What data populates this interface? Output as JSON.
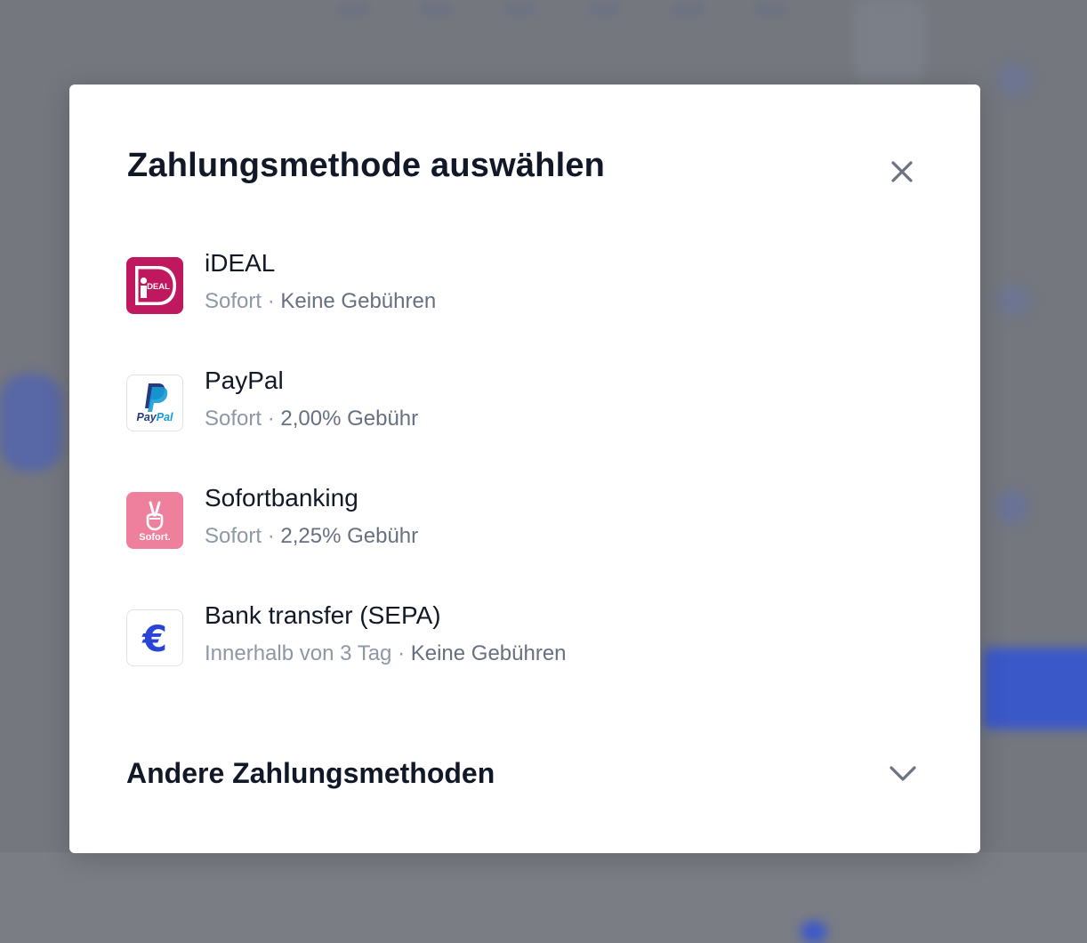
{
  "modal": {
    "title": "Zahlungsmethode auswählen",
    "close_icon": "close-icon"
  },
  "methods": [
    {
      "name": "iDEAL",
      "speed": "Sofort",
      "separator": "·",
      "fee": "Keine Gebühren",
      "icon": "ideal-logo-icon",
      "logo_text": "iDEAL",
      "color": "#c0185f"
    },
    {
      "name": "PayPal",
      "speed": "Sofort",
      "separator": "·",
      "fee": "2,00% Gebühr",
      "icon": "paypal-logo-icon",
      "logo_text": "PayPal",
      "color": "#253b80"
    },
    {
      "name": "Sofortbanking",
      "speed": "Sofort",
      "separator": "·",
      "fee": "2,25% Gebühr",
      "icon": "sofort-logo-icon",
      "logo_text": "Sofort.",
      "color": "#ef809d"
    },
    {
      "name": "Bank transfer (SEPA)",
      "speed": "Innerhalb von 3 Tag",
      "separator": "·",
      "fee": "Keine Gebühren",
      "icon": "euro-icon",
      "logo_text": "€",
      "color": "#2a45d6"
    }
  ],
  "other_methods": {
    "label": "Andere Zahlungsmethoden",
    "icon": "chevron-down-icon"
  },
  "colors": {
    "overlay": "#74777e",
    "title_text": "#111827",
    "muted_text": "#8e97a5",
    "fee_text": "#677080",
    "icon_gray": "#6b7280"
  }
}
